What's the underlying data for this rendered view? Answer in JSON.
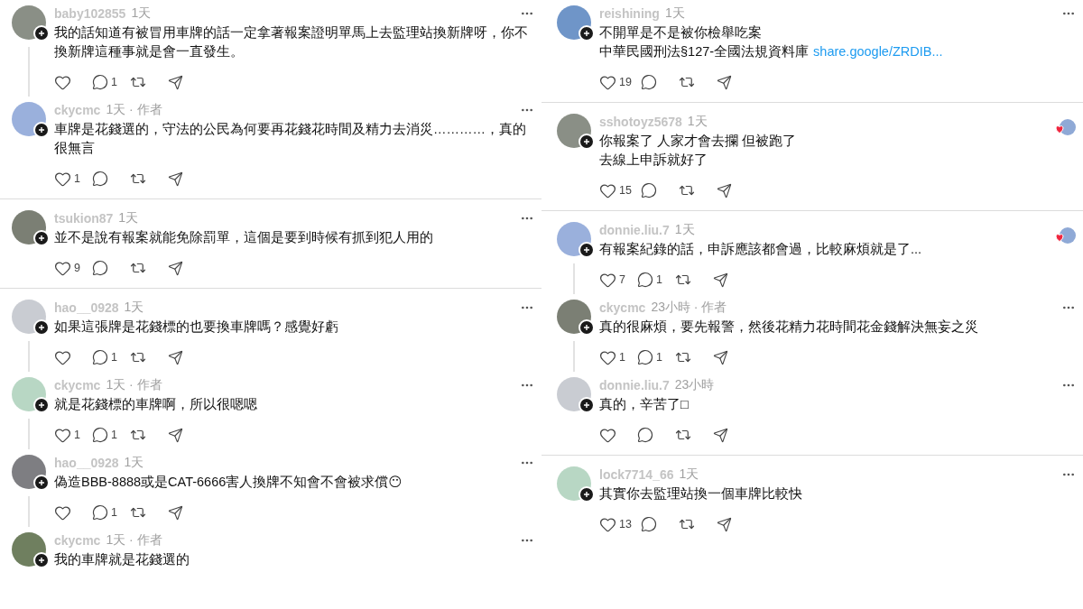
{
  "columns": [
    {
      "groups": [
        {
          "posts": [
            {
              "username": "baby102855",
              "meta": "1天",
              "liked_by_author": false,
              "lines": [
                {
                  "text": "我的話知道有被冒用車牌的話一定拿著報案證明單馬上去監理站換新牌呀，你不換新牌這種事就是會一直發生。"
                }
              ],
              "replies": "1",
              "actions_visible": true
            },
            {
              "username": "ckycmc",
              "meta": "1天 · 作者",
              "liked_by_author": false,
              "lines": [
                {
                  "text": "車牌是花錢選的，守法的公民為何要再花錢花時間及精力去消災…………，真的很無言"
                }
              ],
              "likes": "1",
              "actions_visible": true
            }
          ]
        },
        {
          "posts": [
            {
              "username": "tsukion87",
              "meta": "1天",
              "liked_by_author": false,
              "lines": [
                {
                  "text": "並不是說有報案就能免除罰單，這個是要到時候有抓到犯人用的"
                }
              ],
              "likes": "9",
              "actions_visible": true
            }
          ]
        },
        {
          "posts": [
            {
              "username": "hao__0928",
              "meta": "1天",
              "liked_by_author": false,
              "lines": [
                {
                  "text": "如果這張牌是花錢標的也要換車牌嗎？感覺好虧"
                }
              ],
              "replies": "1",
              "actions_visible": true
            },
            {
              "username": "ckycmc",
              "meta": "1天 · 作者",
              "liked_by_author": false,
              "lines": [
                {
                  "text": "就是花錢標的車牌啊，所以很嗯嗯"
                }
              ],
              "likes": "1",
              "replies": "1",
              "actions_visible": true
            },
            {
              "username": "hao__0928",
              "meta": "1天",
              "liked_by_author": false,
              "lines": [
                {
                  "text": "偽造BBB-8888或是CAT-6666害人換牌不知會不會被求償😶"
                }
              ],
              "replies": "1",
              "actions_visible": true
            },
            {
              "username": "ckycmc",
              "meta": "1天 · 作者",
              "liked_by_author": false,
              "lines": [
                {
                  "text": "我的車牌就是花錢選的"
                }
              ],
              "actions_visible": false
            }
          ]
        }
      ]
    },
    {
      "groups": [
        {
          "posts": [
            {
              "username": "reishining",
              "meta": "1天",
              "liked_by_author": false,
              "lines": [
                {
                  "text": "不開單是不是被你檢舉吃案"
                },
                {
                  "text": "中華民國刑法§127-全國法規資料庫",
                  "link": "share.google/ZRDIB..."
                }
              ],
              "likes": "19",
              "actions_visible": true
            }
          ]
        },
        {
          "posts": [
            {
              "username": "sshotoyz5678",
              "meta": "1天",
              "liked_by_author": true,
              "lines": [
                {
                  "text": "你報案了 人家才會去攔 但被跑了"
                },
                {
                  "text": "去線上申訴就好了"
                }
              ],
              "likes": "15",
              "actions_visible": true
            }
          ]
        },
        {
          "posts": [
            {
              "username": "donnie.liu.7",
              "meta": "1天",
              "liked_by_author": true,
              "lines": [
                {
                  "text": "有報案紀錄的話，申訴應該都會過，比較麻煩就是了..."
                }
              ],
              "likes": "7",
              "replies": "1",
              "actions_visible": true
            },
            {
              "username": "ckycmc",
              "meta": "23小時 · 作者",
              "liked_by_author": false,
              "lines": [
                {
                  "text": "真的很麻煩，要先報警，然後花精力花時間花金錢解決無妄之災"
                }
              ],
              "likes": "1",
              "replies": "1",
              "actions_visible": true
            },
            {
              "username": "donnie.liu.7",
              "meta": "23小時",
              "liked_by_author": false,
              "lines": [
                {
                  "text": "真的，辛苦了□"
                }
              ],
              "actions_visible": true
            }
          ]
        },
        {
          "posts": [
            {
              "username": "lock7714_66",
              "meta": "1天",
              "liked_by_author": false,
              "lines": [
                {
                  "text": "其實你去監理站換一個車牌比較快"
                }
              ],
              "likes": "13",
              "actions_visible": true
            }
          ]
        }
      ]
    }
  ]
}
